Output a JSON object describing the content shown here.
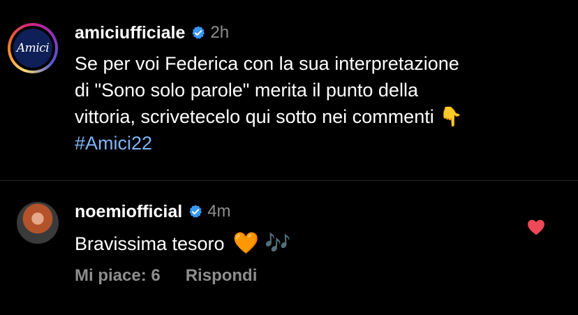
{
  "post": {
    "username": "amiciufficiale",
    "avatar_text": "Amici",
    "time": "2h",
    "caption_lines": [
      "Se per voi Federica con la sua interpretazione",
      "di \"Sono solo parole\" merita il punto della",
      "vittoria, scrivetecelo qui sotto nei commenti 👇"
    ],
    "hashtag": "#Amici22"
  },
  "comment": {
    "username": "noemiofficial",
    "time": "4m",
    "text": "Bravissima tesoro",
    "emojis": "🧡 🎶",
    "likes_label": "Mi piace: 6",
    "reply_label": "Rispondi"
  },
  "colors": {
    "background": "#000000",
    "verified": "#3897f0",
    "muted": "#8e8e8e",
    "hashtag": "#7eb5f5",
    "heart": "#ed4956"
  }
}
